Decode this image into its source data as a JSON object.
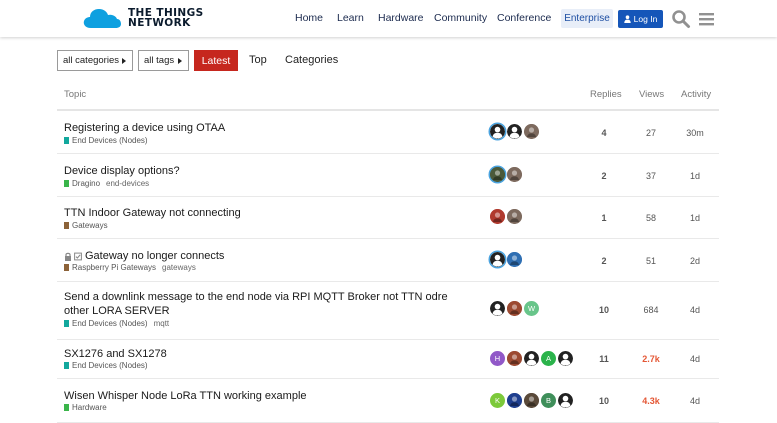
{
  "header": {
    "logo_line1": "THE THINGS",
    "logo_line2": "NETWORK",
    "nav": [
      "Home",
      "Learn",
      "Hardware",
      "Community",
      "Conference"
    ],
    "enterprise_label": "Enterprise",
    "login_label": "Log In",
    "brand_color": "#1556b9"
  },
  "filters": {
    "categories_label": "all categories",
    "tags_label": "all tags",
    "latest_label": "Latest",
    "top_label": "Top",
    "categories_nav_label": "Categories"
  },
  "table": {
    "headers": {
      "topic": "Topic",
      "replies": "Replies",
      "views": "Views",
      "activity": "Activity"
    },
    "rows": [
      {
        "title": "Registering a device using OTAA",
        "category": "End Devices (Nodes)",
        "category_color": "#12a89d",
        "tags": [],
        "posters": [
          {
            "type": "silhouette",
            "bg": "#fff",
            "ring": "#4aa3df"
          },
          {
            "type": "silhouette",
            "bg": "#fff"
          },
          {
            "type": "photo",
            "bg": "#7d6a5e"
          }
        ],
        "replies": "4",
        "views": "27",
        "views_hot": false,
        "activity": "30m"
      },
      {
        "title": "Device display options?",
        "category": "Dragino",
        "category_color": "#3ab54a",
        "tags": [
          "end-devices"
        ],
        "posters": [
          {
            "type": "photo",
            "bg": "#4b5a3a",
            "ring": "#4aa3df"
          },
          {
            "type": "photo",
            "bg": "#7d6a5e"
          }
        ],
        "replies": "2",
        "views": "37",
        "views_hot": false,
        "activity": "1d"
      },
      {
        "title": "TTN Indoor Gateway not connecting",
        "category": "Gateways",
        "category_color": "#8c6238",
        "tags": [],
        "posters": [
          {
            "type": "photo",
            "bg": "#b03a2e"
          },
          {
            "type": "photo",
            "bg": "#7d6a5e"
          }
        ],
        "replies": "1",
        "views": "58",
        "views_hot": false,
        "activity": "1d"
      },
      {
        "title": "Gateway no longer connects",
        "category": "Raspberry Pi Gateways",
        "category_color": "#8c6238",
        "tags": [
          "gateways"
        ],
        "closed": true,
        "posters": [
          {
            "type": "silhouette",
            "bg": "#fff",
            "ring": "#4aa3df"
          },
          {
            "type": "photo",
            "bg": "#2f6fb3"
          }
        ],
        "replies": "2",
        "views": "51",
        "views_hot": false,
        "activity": "2d"
      },
      {
        "title": "Send a downlink message to the end node via RPI MQTT Broker not TTN odre other LORA SERVER",
        "category": "End Devices (Nodes)",
        "category_color": "#12a89d",
        "tags": [
          "mqtt"
        ],
        "posters": [
          {
            "type": "silhouette",
            "bg": "#fff"
          },
          {
            "type": "photo",
            "bg": "#9c4a32"
          },
          {
            "type": "letter",
            "bg": "#68c58a",
            "letter": "W"
          }
        ],
        "replies": "10",
        "views": "684",
        "views_hot": false,
        "activity": "4d"
      },
      {
        "title": "SX1276 and SX1278",
        "category": "End Devices (Nodes)",
        "category_color": "#12a89d",
        "tags": [],
        "posters": [
          {
            "type": "letter",
            "bg": "#9158c8",
            "letter": "H"
          },
          {
            "type": "photo",
            "bg": "#9c4a32"
          },
          {
            "type": "silhouette",
            "bg": "#fff"
          },
          {
            "type": "letter",
            "bg": "#2bb34b",
            "letter": "A"
          },
          {
            "type": "silhouette",
            "bg": "#fff"
          }
        ],
        "replies": "11",
        "views": "2.7k",
        "views_hot": true,
        "activity": "4d"
      },
      {
        "title": "Wisen Whisper Node LoRa TTN working example",
        "category": "Hardware",
        "category_color": "#3ab54a",
        "tags": [],
        "posters": [
          {
            "type": "letter",
            "bg": "#7cc93a",
            "letter": "K"
          },
          {
            "type": "photo",
            "bg": "#1f3f8f"
          },
          {
            "type": "photo",
            "bg": "#5a4a3a"
          },
          {
            "type": "letter",
            "bg": "#3f8f5a",
            "letter": "B"
          },
          {
            "type": "silhouette",
            "bg": "#fff"
          }
        ],
        "replies": "10",
        "views": "4.3k",
        "views_hot": true,
        "activity": "4d"
      }
    ]
  }
}
